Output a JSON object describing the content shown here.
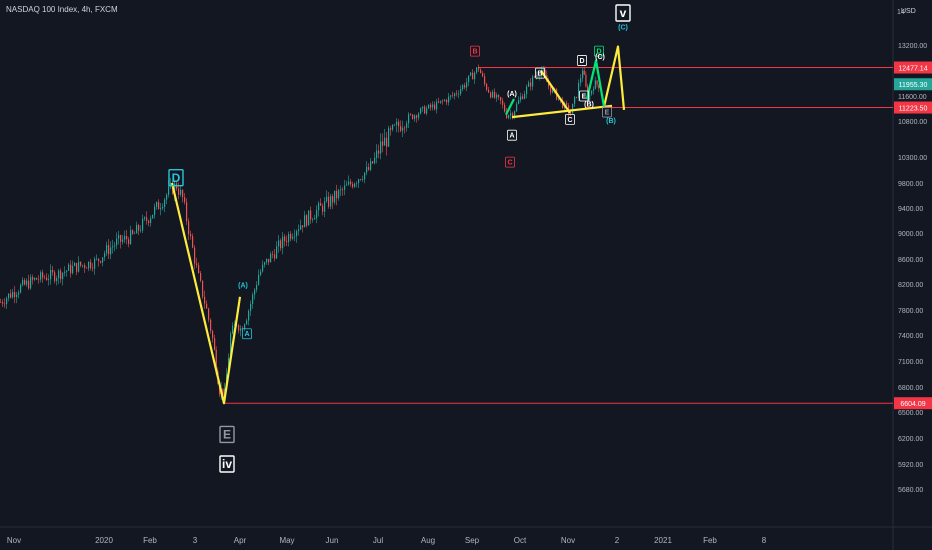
{
  "header": {
    "title": "NASDAQ 100 Index, 4h, FXCM",
    "top_right_tag": "14",
    "currency": "USD"
  },
  "chart_data": {
    "type": "line",
    "title": "NASDAQ 100 Index, 4h, FXCM",
    "xlabel": "",
    "ylabel": "",
    "ylim": [
      5530,
      14300
    ],
    "y_scale": "log",
    "grid": false,
    "legend": "none",
    "x_ticks": [
      "Nov",
      "2020",
      "Feb",
      "3",
      "Apr",
      "May",
      "Jun",
      "Jul",
      "Aug",
      "Sep",
      "Oct",
      "Nov",
      "2",
      "2021",
      "Feb",
      "8"
    ],
    "y_ticks": [
      13200,
      12400,
      11600,
      10800,
      10300,
      9800,
      9400,
      9000,
      8600,
      8200,
      7800,
      7400,
      7100,
      6800,
      6500,
      6200,
      5920,
      5680
    ],
    "series": [
      {
        "values": [
          [
            0,
            7920
          ],
          [
            8,
            8020
          ],
          [
            20,
            8150
          ],
          [
            36,
            8280
          ],
          [
            56,
            8350
          ],
          [
            76,
            8480
          ],
          [
            96,
            8560
          ],
          [
            104,
            8700
          ],
          [
            116,
            8850
          ],
          [
            132,
            8950
          ],
          [
            148,
            9250
          ],
          [
            160,
            9480
          ],
          [
            170,
            9700
          ],
          [
            176,
            9760
          ],
          [
            182,
            9550
          ],
          [
            190,
            8900
          ],
          [
            198,
            8300
          ],
          [
            206,
            7800
          ],
          [
            214,
            7200
          ],
          [
            219,
            6780
          ],
          [
            224,
            6700
          ],
          [
            230,
            7400
          ],
          [
            236,
            7600
          ],
          [
            240,
            7500
          ],
          [
            246,
            7700
          ],
          [
            252,
            8000
          ],
          [
            258,
            8350
          ],
          [
            266,
            8550
          ],
          [
            276,
            8750
          ],
          [
            290,
            9000
          ],
          [
            304,
            9200
          ],
          [
            316,
            9350
          ],
          [
            330,
            9520
          ],
          [
            344,
            9700
          ],
          [
            356,
            9880
          ],
          [
            368,
            10050
          ],
          [
            380,
            10450
          ],
          [
            396,
            10700
          ],
          [
            408,
            10900
          ],
          [
            420,
            11100
          ],
          [
            436,
            11300
          ],
          [
            452,
            11600
          ],
          [
            464,
            11950
          ],
          [
            472,
            12250
          ],
          [
            478,
            12480
          ],
          [
            484,
            11950
          ],
          [
            492,
            11600
          ],
          [
            500,
            11400
          ],
          [
            506,
            11000
          ],
          [
            512,
            11050
          ],
          [
            520,
            11550
          ],
          [
            528,
            11900
          ],
          [
            534,
            12200
          ],
          [
            541,
            12400
          ],
          [
            548,
            11900
          ],
          [
            556,
            11600
          ],
          [
            564,
            11250
          ],
          [
            570,
            11050
          ],
          [
            576,
            11650
          ],
          [
            582,
            12450
          ],
          [
            587,
            11500
          ],
          [
            593,
            11950
          ],
          [
            600,
            11955
          ]
        ]
      }
    ],
    "price_labels": [
      {
        "value": 12477.14,
        "text": "12477.14",
        "bg": "#f23645"
      },
      {
        "value": 11955.3,
        "text": "11955.30",
        "bg": "#26a69a"
      },
      {
        "value": 11223.5,
        "text": "11223.50",
        "bg": "#f23645"
      },
      {
        "value": 6604.09,
        "text": "6604.09",
        "bg": "#f23645"
      }
    ],
    "horizontal_lines": [
      {
        "value": 12477.14,
        "x_start": 478,
        "color": "#f23645"
      },
      {
        "value": 11223.5,
        "x_start": 586,
        "color": "#f23645"
      },
      {
        "value": 6604.09,
        "x_start": 224,
        "color": "#f23645"
      }
    ],
    "wave_lines": [
      {
        "color": "#ffeb3b",
        "points": [
          [
            172,
            9800
          ],
          [
            224,
            6604
          ],
          [
            240,
            8000
          ]
        ]
      },
      {
        "color": "#ffeb3b",
        "points": [
          [
            541,
            12380
          ],
          [
            570,
            11050
          ]
        ]
      },
      {
        "color": "#ffeb3b",
        "points": [
          [
            512,
            10920
          ],
          [
            612,
            11280
          ]
        ]
      },
      {
        "color": "#ffeb3b",
        "points": [
          [
            604,
            11250
          ],
          [
            618,
            13150
          ],
          [
            624,
            11150
          ]
        ]
      },
      {
        "color": "#00e676",
        "points": [
          [
            587,
            11500
          ],
          [
            596,
            12700
          ],
          [
            604,
            11250
          ]
        ]
      },
      {
        "color": "#00e676",
        "points": [
          [
            506,
            11000
          ],
          [
            514,
            11500
          ]
        ]
      }
    ],
    "wave_labels": [
      {
        "text": "D",
        "x": 176,
        "y": 9900,
        "color": "#26c6da",
        "boxed": true,
        "big": true
      },
      {
        "text": "E",
        "x": 227,
        "y": 6240,
        "color": "#9598a1",
        "boxed": true,
        "big": true
      },
      {
        "text": "iv",
        "x": 227,
        "y": 5920,
        "color": "#ffffff",
        "boxed": true,
        "big": true
      },
      {
        "text": "(A)",
        "x": 243,
        "y": 8180,
        "color": "#26c6da",
        "boxed": false,
        "big": false
      },
      {
        "text": "A",
        "x": 247,
        "y": 7420,
        "color": "#26c6da",
        "boxed": true,
        "big": false
      },
      {
        "text": "B",
        "x": 475,
        "y": 13000,
        "color": "#f23645",
        "boxed": true,
        "big": false
      },
      {
        "text": "(A)",
        "x": 512,
        "y": 11680,
        "color": "#ffffff",
        "boxed": false,
        "big": false
      },
      {
        "text": "A",
        "x": 512,
        "y": 10600,
        "color": "#ffffff",
        "boxed": true,
        "big": false
      },
      {
        "text": "C",
        "x": 510,
        "y": 10200,
        "color": "#f23645",
        "boxed": true,
        "big": false
      },
      {
        "text": "B",
        "x": 540,
        "y": 12300,
        "color": "#ffffff",
        "boxed": true,
        "big": false
      },
      {
        "text": "C",
        "x": 570,
        "y": 10850,
        "color": "#ffffff",
        "boxed": true,
        "big": false
      },
      {
        "text": "D",
        "x": 582,
        "y": 12700,
        "color": "#ffffff",
        "boxed": true,
        "big": false
      },
      {
        "text": "E",
        "x": 584,
        "y": 11600,
        "color": "#ffffff",
        "boxed": true,
        "big": false
      },
      {
        "text": "(B)",
        "x": 589,
        "y": 11330,
        "color": "#ffffff",
        "boxed": false,
        "big": false
      },
      {
        "text": "D",
        "x": 599,
        "y": 13000,
        "color": "#00e676",
        "boxed": true,
        "big": false
      },
      {
        "text": "(C)",
        "x": 600,
        "y": 12820,
        "color": "#ffffff",
        "boxed": false,
        "big": false
      },
      {
        "text": "E",
        "x": 607,
        "y": 11080,
        "color": "#9598a1",
        "boxed": true,
        "big": false
      },
      {
        "text": "(B)",
        "x": 611,
        "y": 10820,
        "color": "#26c6da",
        "boxed": false,
        "big": false
      },
      {
        "text": "(C)",
        "x": 623,
        "y": 13800,
        "color": "#26c6da",
        "boxed": false,
        "big": false
      },
      {
        "text": "v",
        "x": 623,
        "y": 14300,
        "color": "#ffffff",
        "boxed": true,
        "big": true
      }
    ]
  }
}
